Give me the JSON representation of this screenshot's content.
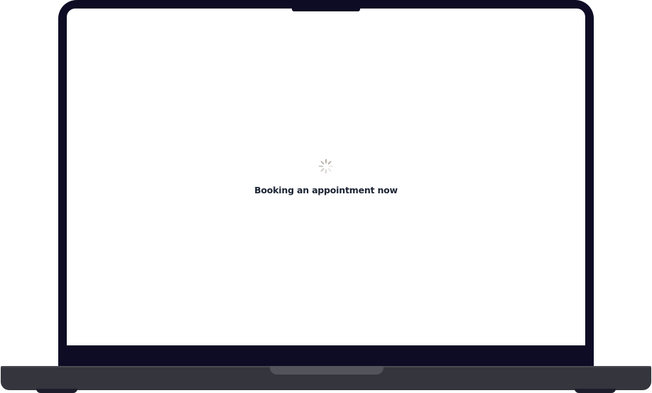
{
  "loading": {
    "message": "Booking an appointment now",
    "spinner_icon": "loading-spinner-icon"
  },
  "colors": {
    "bezel": "#0e0b25",
    "base": "#35353d",
    "screen": "#ffffff",
    "text": "#1b2333",
    "spinner": "#a39a8c"
  }
}
